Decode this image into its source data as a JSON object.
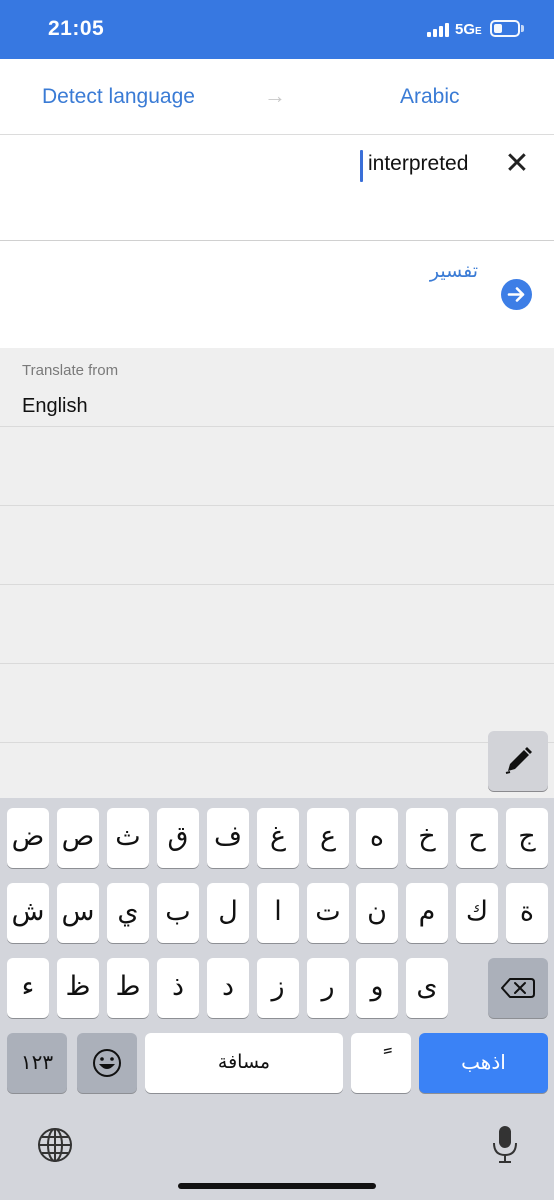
{
  "status_bar": {
    "time": "21:05",
    "network": "5G",
    "network_suffix": "E",
    "icons": [
      "signal-icon",
      "battery-icon"
    ]
  },
  "language_bar": {
    "source": "Detect language",
    "arrow": "→",
    "target": "Arabic"
  },
  "input": {
    "text": "interpreted",
    "clear_icon": "✕"
  },
  "result": {
    "text": "تفسير",
    "go_icon": "arrow-right-icon"
  },
  "suggestions": {
    "caption": "Translate from",
    "value": "English"
  },
  "keyboard": {
    "row1": [
      "ض",
      "ص",
      "ث",
      "ق",
      "ف",
      "غ",
      "ع",
      "ه",
      "خ",
      "ح",
      "ج"
    ],
    "row2": [
      "ش",
      "س",
      "ي",
      "ب",
      "ل",
      "ا",
      "ت",
      "ن",
      "م",
      "ك",
      "ة"
    ],
    "row3": [
      "ء",
      "ظ",
      "ط",
      "ذ",
      "د",
      "ز",
      "ر",
      "و",
      "ى"
    ],
    "numbers_label": "١٢٣",
    "space_label": "مسافة",
    "tanween_label": "ً",
    "go_label": "اذهب",
    "icons": [
      "emoji-icon",
      "backspace-icon",
      "globe-icon",
      "microphone-icon",
      "pen-icon"
    ]
  },
  "colors": {
    "accent": "#3a7bd5",
    "status_bar": "#3778e1",
    "go_key": "#3a82f6"
  }
}
